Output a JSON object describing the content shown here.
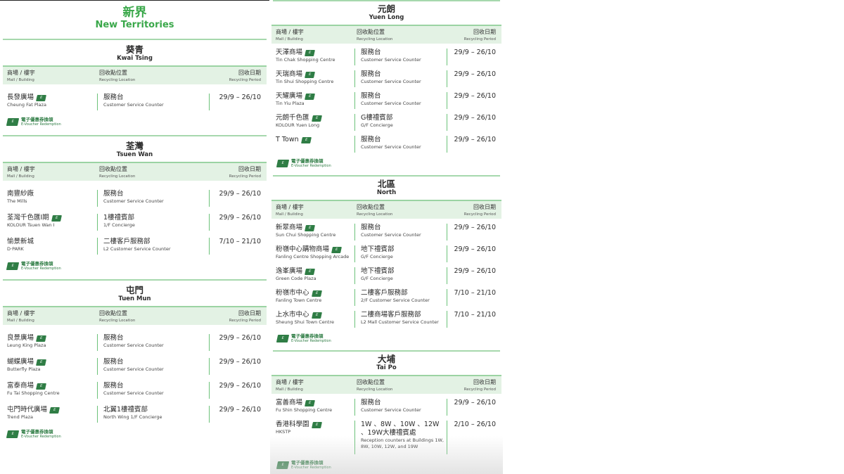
{
  "legend": {
    "tag": "E",
    "zh": "電子優惠券換領",
    "en": "E-Voucher Redemption"
  },
  "table_head": {
    "mall_zh": "商場 / 樓宇",
    "mall_en": "Mall / Building",
    "loc_zh": "回收點位置",
    "loc_en": "Recycling Location",
    "period_zh": "回收日期",
    "period_en": "Recycling Period"
  },
  "left": {
    "title_zh": "新界",
    "title_en": "New Territories",
    "sections": [
      {
        "zh": "葵青",
        "en": "Kwai Tsing",
        "rows": [
          {
            "mall_zh": "長發廣場",
            "mall_en": "Cheung Fat Plaza",
            "ev": true,
            "loc_zh": "服務台",
            "loc_en": "Customer Service Counter",
            "period": "29/9 – 26/10"
          }
        ]
      },
      {
        "zh": "荃灣",
        "en": "Tsuen Wan",
        "rows": [
          {
            "mall_zh": "南豐紗廠",
            "mall_en": "The Mills",
            "ev": false,
            "loc_zh": "服務台",
            "loc_en": "Customer Service Counter",
            "period": "29/9 – 26/10"
          },
          {
            "mall_zh": "荃灣千色匯I期",
            "mall_en": "KOLOUR Tsuen Wan I",
            "ev": true,
            "loc_zh": "1樓禮賓部",
            "loc_en": "1/F Concierge",
            "period": "29/9 – 26/10"
          },
          {
            "mall_zh": "愉景新城",
            "mall_en": "D·PARK",
            "ev": false,
            "loc_zh": "二樓客戶服務部",
            "loc_en": "L2 Customer Service Counter",
            "period": "7/10 – 21/10"
          }
        ]
      },
      {
        "zh": "屯門",
        "en": "Tuen Mun",
        "rows": [
          {
            "mall_zh": "良景廣場",
            "mall_en": "Leung King Plaza",
            "ev": true,
            "loc_zh": "服務台",
            "loc_en": "Customer Service Counter",
            "period": "29/9 – 26/10"
          },
          {
            "mall_zh": "蝴蝶廣場",
            "mall_en": "Butterfly Plaza",
            "ev": true,
            "loc_zh": "服務台",
            "loc_en": "Customer Service Counter",
            "period": "29/9 – 26/10"
          },
          {
            "mall_zh": "富泰商場",
            "mall_en": "Fu Tai Shopping Centre",
            "ev": true,
            "loc_zh": "服務台",
            "loc_en": "Customer Service Counter",
            "period": "29/9 – 26/10"
          },
          {
            "mall_zh": "屯門時代廣場",
            "mall_en": "Trend Plaza",
            "ev": true,
            "loc_zh": "北翼1樓禮賓部",
            "loc_en": "North Wing 1/F Concierge",
            "period": "29/9 – 26/10"
          }
        ]
      }
    ]
  },
  "right": {
    "sections": [
      {
        "zh": "元朗",
        "en": "Yuen Long",
        "rows": [
          {
            "mall_zh": "天澤商場",
            "mall_en": "Tin Chak Shopping Centre",
            "ev": true,
            "loc_zh": "服務台",
            "loc_en": "Customer Service Counter",
            "period": "29/9 – 26/10"
          },
          {
            "mall_zh": "天瑞商場",
            "mall_en": "Tin Shui Shopping Centre",
            "ev": true,
            "loc_zh": "服務台",
            "loc_en": "Customer Service Counter",
            "period": "29/9 – 26/10"
          },
          {
            "mall_zh": "天耀廣場",
            "mall_en": "Tin Yiu Plaza",
            "ev": true,
            "loc_zh": "服務台",
            "loc_en": "Customer Service Counter",
            "period": "29/9 – 26/10"
          },
          {
            "mall_zh": "元朗千色匯",
            "mall_en": "KOLOUR Yuen Long",
            "ev": true,
            "loc_zh": "G樓禮賓部",
            "loc_en": "G/F Concierge",
            "period": "29/9 – 26/10"
          },
          {
            "mall_zh": "T Town",
            "mall_en": "",
            "ev": true,
            "loc_zh": "服務台",
            "loc_en": "Customer Service Counter",
            "period": "29/9 – 26/10"
          }
        ]
      },
      {
        "zh": "北區",
        "en": "North",
        "rows": [
          {
            "mall_zh": "新翠商場",
            "mall_en": "Sun Chui Shopping Centre",
            "ev": true,
            "loc_zh": "服務台",
            "loc_en": "Customer Service Counter",
            "period": "29/9 – 26/10"
          },
          {
            "mall_zh": "粉嶺中心購物商場",
            "mall_en": "Fanling Centre Shopping Arcade",
            "ev": true,
            "loc_zh": "地下禮賓部",
            "loc_en": "G/F Concierge",
            "period": "29/9 – 26/10"
          },
          {
            "mall_zh": "逸峯廣場",
            "mall_en": "Green Code Plaza",
            "ev": true,
            "loc_zh": "地下禮賓部",
            "loc_en": "G/F Concierge",
            "period": "29/9 – 26/10"
          },
          {
            "mall_zh": "粉嶺市中心",
            "mall_en": "Fanling Town Centre",
            "ev": true,
            "loc_zh": "二樓客戶服務部",
            "loc_en": "2/F Customer Service Counter",
            "period": "7/10 – 21/10"
          },
          {
            "mall_zh": "上水市中心",
            "mall_en": "Sheung Shui Town Centre",
            "ev": true,
            "loc_zh": "二樓商場客戶服務部",
            "loc_en": "L2 Mall Customer Service Counter",
            "period": "7/10 – 21/10"
          }
        ]
      },
      {
        "zh": "大埔",
        "en": "Tai Po",
        "rows": [
          {
            "mall_zh": "富善商場",
            "mall_en": "Fu Shin Shopping Centre",
            "ev": true,
            "loc_zh": "服務台",
            "loc_en": "Customer Service Counter",
            "period": "29/9 – 26/10"
          },
          {
            "mall_zh": "香港科學園",
            "mall_en": "HKSTP",
            "ev": true,
            "loc_zh": "1W 、8W 、10W 、12W 、19W大樓禮賓處",
            "loc_en": "Reception counters at Buildings 1W, 8W, 10W, 12W, and 19W",
            "period": "2/10 – 26/10"
          }
        ]
      }
    ]
  }
}
